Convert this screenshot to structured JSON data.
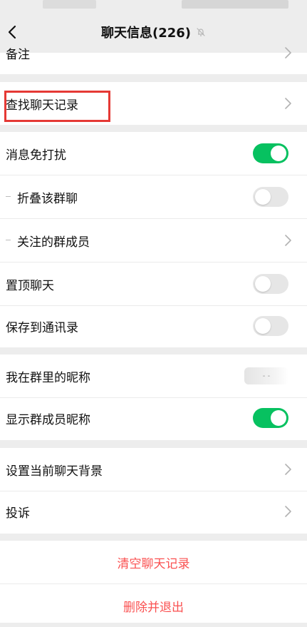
{
  "header": {
    "title": "聊天信息(226)"
  },
  "rows": {
    "remark": "备注",
    "search_history": "查找聊天记录",
    "mute": "消息免打扰",
    "fold_group": "折叠该群聊",
    "followed_members": "关注的群成员",
    "pin_chat": "置顶聊天",
    "save_contacts": "保存到通讯录",
    "my_nickname": "我在群里的昵称",
    "nickname_value": "- -",
    "show_member_nicknames": "显示群成员昵称",
    "set_background": "设置当前聊天背景",
    "complain": "投诉"
  },
  "actions": {
    "clear_history": "清空聊天记录",
    "delete_exit": "删除并退出"
  },
  "toggles": {
    "mute": true,
    "fold_group": false,
    "pin_chat": false,
    "save_contacts": false,
    "show_member_nicknames": true
  },
  "colors": {
    "accent": "#07c160",
    "danger": "#fa5151",
    "highlight_box": "#e53935",
    "background": "#ededed"
  },
  "icons": {
    "back": "chevron-left-icon",
    "mute_indicator": "muted-bell-icon",
    "row_arrow": "chevron-right-icon"
  }
}
